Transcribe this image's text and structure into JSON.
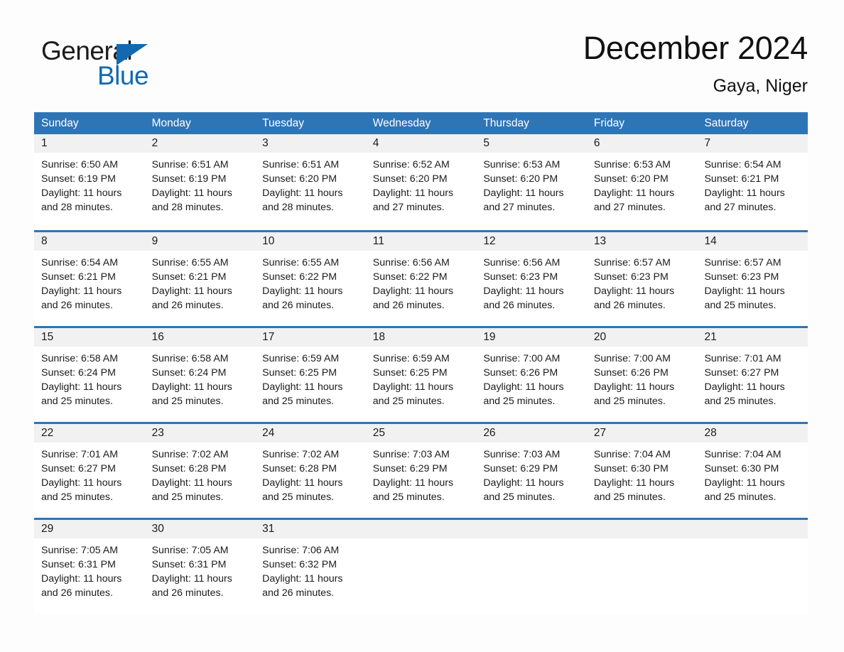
{
  "brand": {
    "name_top": "General",
    "name_bottom": "Blue",
    "accent_color": "#1269b0"
  },
  "header": {
    "title": "December 2024",
    "subtitle": "Gaya, Niger"
  },
  "theme": {
    "header_blue": "#2e75b6",
    "day_band_gray": "#f1f1f1",
    "page_background": "#fdfdfd",
    "text_color": "#1b1b1b"
  },
  "calendar": {
    "day_names": [
      "Sunday",
      "Monday",
      "Tuesday",
      "Wednesday",
      "Thursday",
      "Friday",
      "Saturday"
    ],
    "weeks": [
      [
        {
          "day": "1",
          "sunrise": "Sunrise: 6:50 AM",
          "sunset": "Sunset: 6:19 PM",
          "daylight_line1": "Daylight: 11 hours",
          "daylight_line2": "and 28 minutes."
        },
        {
          "day": "2",
          "sunrise": "Sunrise: 6:51 AM",
          "sunset": "Sunset: 6:19 PM",
          "daylight_line1": "Daylight: 11 hours",
          "daylight_line2": "and 28 minutes."
        },
        {
          "day": "3",
          "sunrise": "Sunrise: 6:51 AM",
          "sunset": "Sunset: 6:20 PM",
          "daylight_line1": "Daylight: 11 hours",
          "daylight_line2": "and 28 minutes."
        },
        {
          "day": "4",
          "sunrise": "Sunrise: 6:52 AM",
          "sunset": "Sunset: 6:20 PM",
          "daylight_line1": "Daylight: 11 hours",
          "daylight_line2": "and 27 minutes."
        },
        {
          "day": "5",
          "sunrise": "Sunrise: 6:53 AM",
          "sunset": "Sunset: 6:20 PM",
          "daylight_line1": "Daylight: 11 hours",
          "daylight_line2": "and 27 minutes."
        },
        {
          "day": "6",
          "sunrise": "Sunrise: 6:53 AM",
          "sunset": "Sunset: 6:20 PM",
          "daylight_line1": "Daylight: 11 hours",
          "daylight_line2": "and 27 minutes."
        },
        {
          "day": "7",
          "sunrise": "Sunrise: 6:54 AM",
          "sunset": "Sunset: 6:21 PM",
          "daylight_line1": "Daylight: 11 hours",
          "daylight_line2": "and 27 minutes."
        }
      ],
      [
        {
          "day": "8",
          "sunrise": "Sunrise: 6:54 AM",
          "sunset": "Sunset: 6:21 PM",
          "daylight_line1": "Daylight: 11 hours",
          "daylight_line2": "and 26 minutes."
        },
        {
          "day": "9",
          "sunrise": "Sunrise: 6:55 AM",
          "sunset": "Sunset: 6:21 PM",
          "daylight_line1": "Daylight: 11 hours",
          "daylight_line2": "and 26 minutes."
        },
        {
          "day": "10",
          "sunrise": "Sunrise: 6:55 AM",
          "sunset": "Sunset: 6:22 PM",
          "daylight_line1": "Daylight: 11 hours",
          "daylight_line2": "and 26 minutes."
        },
        {
          "day": "11",
          "sunrise": "Sunrise: 6:56 AM",
          "sunset": "Sunset: 6:22 PM",
          "daylight_line1": "Daylight: 11 hours",
          "daylight_line2": "and 26 minutes."
        },
        {
          "day": "12",
          "sunrise": "Sunrise: 6:56 AM",
          "sunset": "Sunset: 6:23 PM",
          "daylight_line1": "Daylight: 11 hours",
          "daylight_line2": "and 26 minutes."
        },
        {
          "day": "13",
          "sunrise": "Sunrise: 6:57 AM",
          "sunset": "Sunset: 6:23 PM",
          "daylight_line1": "Daylight: 11 hours",
          "daylight_line2": "and 26 minutes."
        },
        {
          "day": "14",
          "sunrise": "Sunrise: 6:57 AM",
          "sunset": "Sunset: 6:23 PM",
          "daylight_line1": "Daylight: 11 hours",
          "daylight_line2": "and 25 minutes."
        }
      ],
      [
        {
          "day": "15",
          "sunrise": "Sunrise: 6:58 AM",
          "sunset": "Sunset: 6:24 PM",
          "daylight_line1": "Daylight: 11 hours",
          "daylight_line2": "and 25 minutes."
        },
        {
          "day": "16",
          "sunrise": "Sunrise: 6:58 AM",
          "sunset": "Sunset: 6:24 PM",
          "daylight_line1": "Daylight: 11 hours",
          "daylight_line2": "and 25 minutes."
        },
        {
          "day": "17",
          "sunrise": "Sunrise: 6:59 AM",
          "sunset": "Sunset: 6:25 PM",
          "daylight_line1": "Daylight: 11 hours",
          "daylight_line2": "and 25 minutes."
        },
        {
          "day": "18",
          "sunrise": "Sunrise: 6:59 AM",
          "sunset": "Sunset: 6:25 PM",
          "daylight_line1": "Daylight: 11 hours",
          "daylight_line2": "and 25 minutes."
        },
        {
          "day": "19",
          "sunrise": "Sunrise: 7:00 AM",
          "sunset": "Sunset: 6:26 PM",
          "daylight_line1": "Daylight: 11 hours",
          "daylight_line2": "and 25 minutes."
        },
        {
          "day": "20",
          "sunrise": "Sunrise: 7:00 AM",
          "sunset": "Sunset: 6:26 PM",
          "daylight_line1": "Daylight: 11 hours",
          "daylight_line2": "and 25 minutes."
        },
        {
          "day": "21",
          "sunrise": "Sunrise: 7:01 AM",
          "sunset": "Sunset: 6:27 PM",
          "daylight_line1": "Daylight: 11 hours",
          "daylight_line2": "and 25 minutes."
        }
      ],
      [
        {
          "day": "22",
          "sunrise": "Sunrise: 7:01 AM",
          "sunset": "Sunset: 6:27 PM",
          "daylight_line1": "Daylight: 11 hours",
          "daylight_line2": "and 25 minutes."
        },
        {
          "day": "23",
          "sunrise": "Sunrise: 7:02 AM",
          "sunset": "Sunset: 6:28 PM",
          "daylight_line1": "Daylight: 11 hours",
          "daylight_line2": "and 25 minutes."
        },
        {
          "day": "24",
          "sunrise": "Sunrise: 7:02 AM",
          "sunset": "Sunset: 6:28 PM",
          "daylight_line1": "Daylight: 11 hours",
          "daylight_line2": "and 25 minutes."
        },
        {
          "day": "25",
          "sunrise": "Sunrise: 7:03 AM",
          "sunset": "Sunset: 6:29 PM",
          "daylight_line1": "Daylight: 11 hours",
          "daylight_line2": "and 25 minutes."
        },
        {
          "day": "26",
          "sunrise": "Sunrise: 7:03 AM",
          "sunset": "Sunset: 6:29 PM",
          "daylight_line1": "Daylight: 11 hours",
          "daylight_line2": "and 25 minutes."
        },
        {
          "day": "27",
          "sunrise": "Sunrise: 7:04 AM",
          "sunset": "Sunset: 6:30 PM",
          "daylight_line1": "Daylight: 11 hours",
          "daylight_line2": "and 25 minutes."
        },
        {
          "day": "28",
          "sunrise": "Sunrise: 7:04 AM",
          "sunset": "Sunset: 6:30 PM",
          "daylight_line1": "Daylight: 11 hours",
          "daylight_line2": "and 25 minutes."
        }
      ],
      [
        {
          "day": "29",
          "sunrise": "Sunrise: 7:05 AM",
          "sunset": "Sunset: 6:31 PM",
          "daylight_line1": "Daylight: 11 hours",
          "daylight_line2": "and 26 minutes."
        },
        {
          "day": "30",
          "sunrise": "Sunrise: 7:05 AM",
          "sunset": "Sunset: 6:31 PM",
          "daylight_line1": "Daylight: 11 hours",
          "daylight_line2": "and 26 minutes."
        },
        {
          "day": "31",
          "sunrise": "Sunrise: 7:06 AM",
          "sunset": "Sunset: 6:32 PM",
          "daylight_line1": "Daylight: 11 hours",
          "daylight_line2": "and 26 minutes."
        },
        {
          "day": "",
          "sunrise": "",
          "sunset": "",
          "daylight_line1": "",
          "daylight_line2": ""
        },
        {
          "day": "",
          "sunrise": "",
          "sunset": "",
          "daylight_line1": "",
          "daylight_line2": ""
        },
        {
          "day": "",
          "sunrise": "",
          "sunset": "",
          "daylight_line1": "",
          "daylight_line2": ""
        },
        {
          "day": "",
          "sunrise": "",
          "sunset": "",
          "daylight_line1": "",
          "daylight_line2": ""
        }
      ]
    ]
  }
}
